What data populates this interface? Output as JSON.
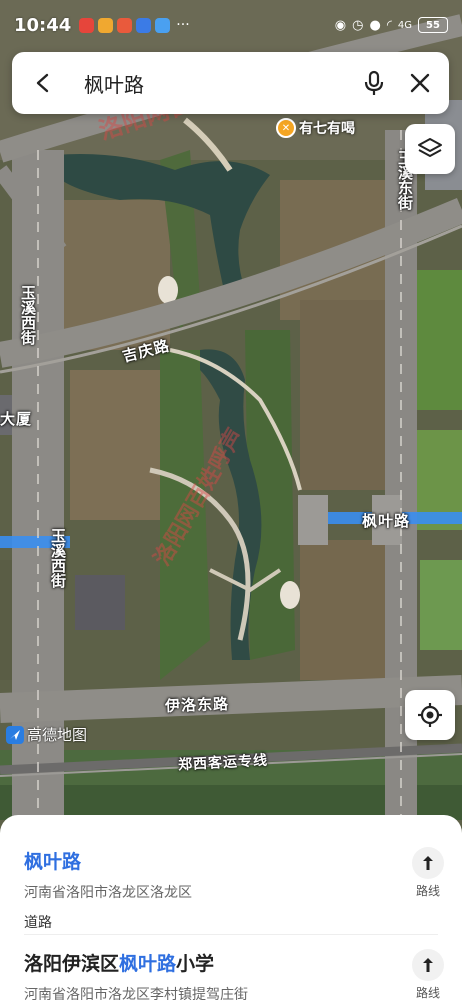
{
  "status_bar": {
    "time": "10:44",
    "more": "···",
    "network": "4G",
    "battery": "55"
  },
  "search": {
    "query": "枫叶路"
  },
  "map": {
    "poi": "有七有喝",
    "roads": {
      "yuxi_east": "玉溪东街",
      "yuxi_west_top": "玉溪西街",
      "yuxi_west_bottom": "玉溪西街",
      "jiqing": "吉庆路",
      "fengye": "枫叶路",
      "yiluo_east": "伊洛东路",
      "zhengxi": "郑西客运专线",
      "dasha": "大厦"
    },
    "logo": "高德地图"
  },
  "watermark": "洛阳网百姓呼声",
  "results": [
    {
      "name_highlight": "枫叶路",
      "name_prefix": "",
      "name_suffix": "",
      "address": "河南省洛阳市洛龙区洛龙区",
      "type": "道路",
      "route_label": "路线"
    },
    {
      "name_prefix": "洛阳伊滨区",
      "name_highlight": "枫叶路",
      "name_suffix": "小学",
      "address": "河南省洛阳市洛龙区李村镇提驾庄街",
      "route_label": "路线"
    }
  ],
  "colors": {
    "highlight": "#2f6fe0",
    "poi": "#f5a623"
  }
}
